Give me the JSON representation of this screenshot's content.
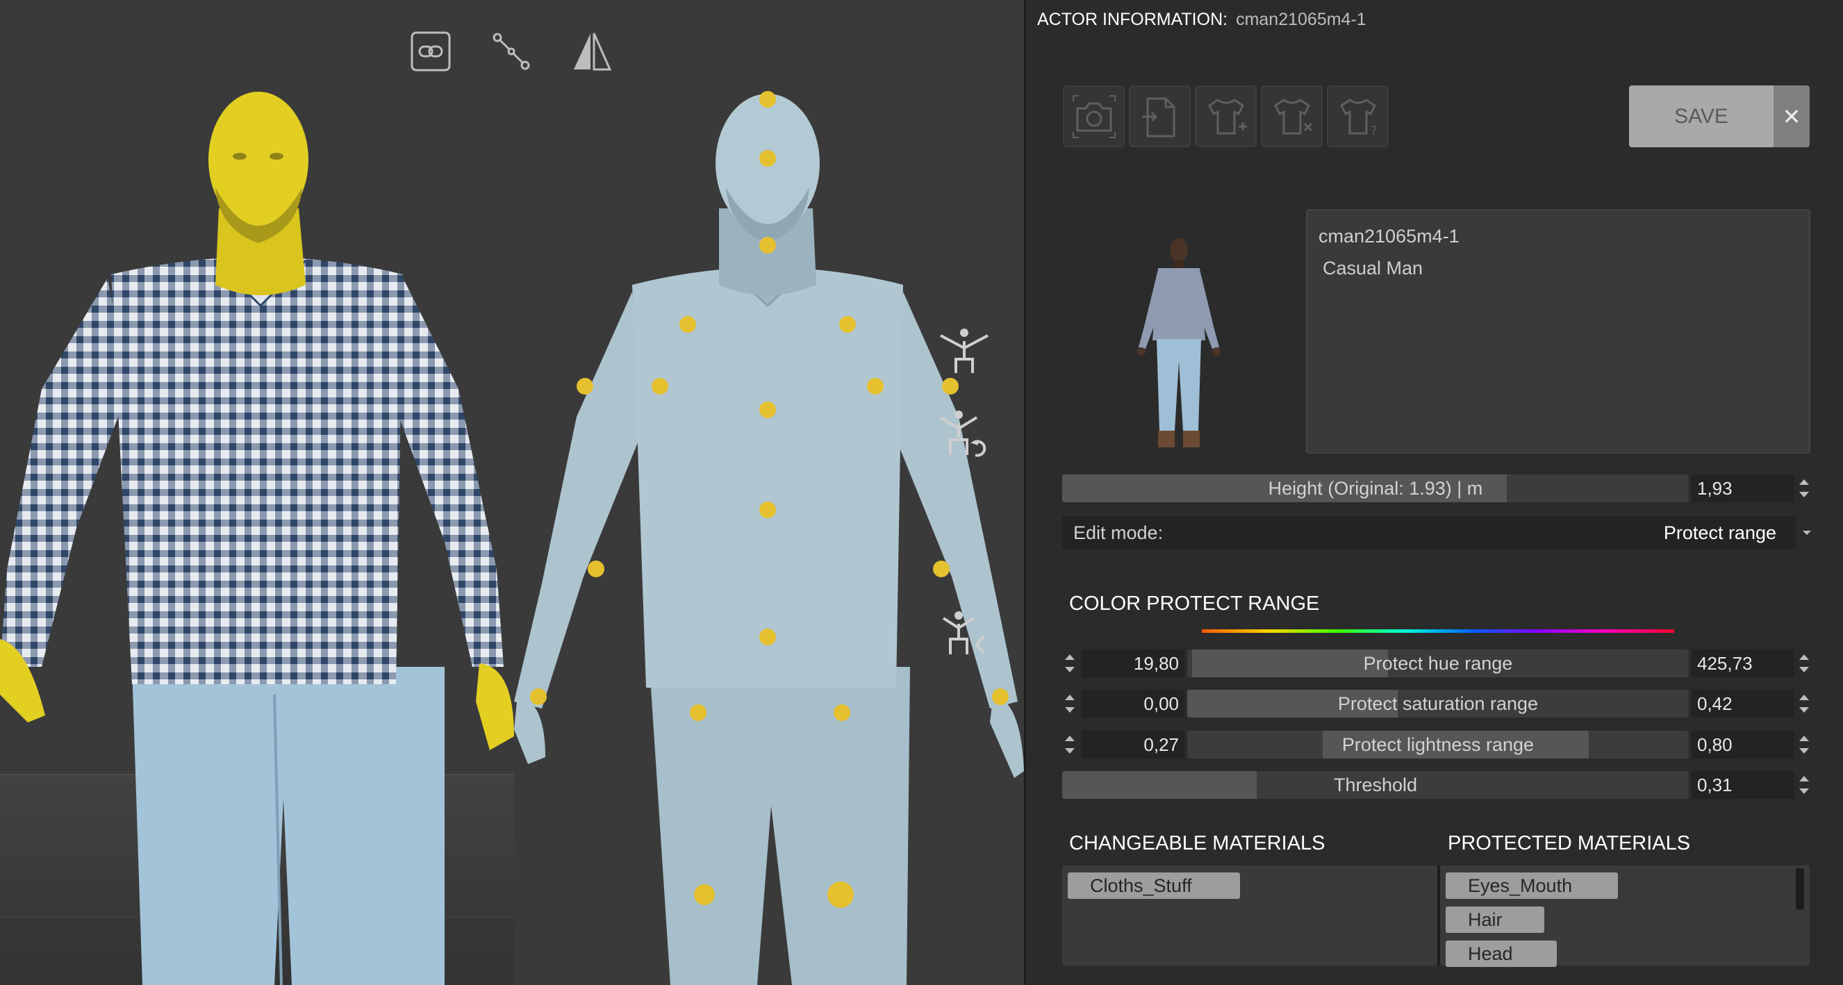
{
  "header": {
    "label": "ACTOR INFORMATION:",
    "actor_id": "cman21065m4-1"
  },
  "viewport": {
    "tools": [
      {
        "name": "link-icon"
      },
      {
        "name": "bone-icon"
      },
      {
        "name": "mirror-icon"
      }
    ],
    "pose_buttons": [
      "t-pose-icon",
      "reset-pose-icon",
      "rotate-pose-icon"
    ]
  },
  "toolbar": {
    "icons": [
      "camera-icon",
      "import-file-icon",
      "add-clothing-icon",
      "remove-clothing-icon",
      "clothing-help-icon"
    ],
    "save_label": "SAVE",
    "close_label": "✕"
  },
  "actor": {
    "name": "cman21065m4-1",
    "description": "Casual Man"
  },
  "height": {
    "label": "Height (Original: 1.93) | m",
    "value": "1,93",
    "fill": 0.71
  },
  "edit_mode": {
    "label": "Edit mode:",
    "value": "Protect range"
  },
  "color_protect": {
    "title": "COLOR PROTECT RANGE",
    "rows": [
      {
        "label": "Protect hue range",
        "min": "19,80",
        "max": "425,73",
        "fill_start": 0.01,
        "fill_end": 0.4
      },
      {
        "label": "Protect saturation range",
        "min": "0,00",
        "max": "0,42",
        "fill_start": 0.0,
        "fill_end": 0.42
      },
      {
        "label": "Protect lightness range",
        "min": "0,27",
        "max": "0,80",
        "fill_start": 0.27,
        "fill_end": 0.8
      }
    ],
    "threshold": {
      "label": "Threshold",
      "value": "0,31",
      "fill": 0.31
    }
  },
  "materials": {
    "changeable_title": "CHANGEABLE MATERIALS",
    "protected_title": "PROTECTED MATERIALS",
    "changeable": [
      "Cloths_Stuff"
    ],
    "protected": [
      "Eyes_Mouth",
      "Hair",
      "Head"
    ]
  },
  "colors": {
    "highlight": "#e2cf22",
    "joint": "#e6c12f",
    "body": "#a9c2cd",
    "shirt_blue": "#3c5576"
  }
}
